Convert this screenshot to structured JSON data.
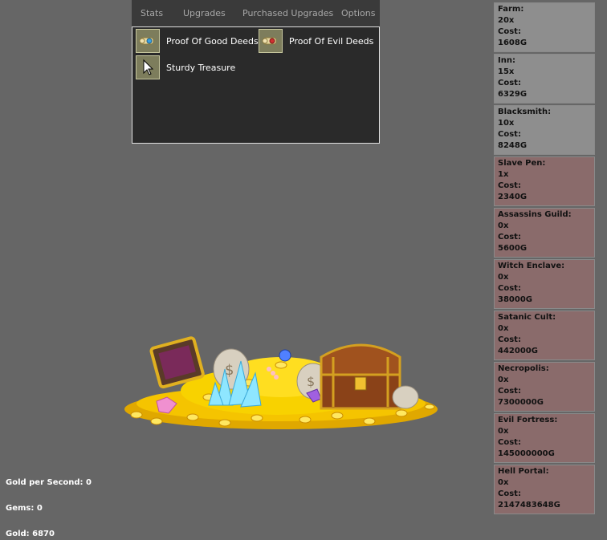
{
  "tabs": {
    "stats": "Stats",
    "upgrades": "Upgrades",
    "purchased": "Purchased Upgrades",
    "options": "Options"
  },
  "upgrades": [
    {
      "label": "Proof Of Good Deeds",
      "icon": "scroll-good-icon"
    },
    {
      "label": "Proof Of Evil Deeds",
      "icon": "scroll-evil-icon"
    },
    {
      "label": "Sturdy Treasure",
      "icon": "cursor-icon"
    }
  ],
  "buildings": [
    {
      "name": "Farm:",
      "count": "20x",
      "cost_label": "Cost:",
      "cost": "1608G",
      "type": "good"
    },
    {
      "name": "Inn:",
      "count": "15x",
      "cost_label": "Cost:",
      "cost": "6329G",
      "type": "good"
    },
    {
      "name": "Blacksmith:",
      "count": "10x",
      "cost_label": "Cost:",
      "cost": "8248G",
      "type": "good"
    },
    {
      "name": "Slave Pen:",
      "count": "1x",
      "cost_label": "Cost:",
      "cost": "2340G",
      "type": "evil"
    },
    {
      "name": "Assassins Guild:",
      "count": "0x",
      "cost_label": "Cost:",
      "cost": "5600G",
      "type": "evil"
    },
    {
      "name": "Witch Enclave:",
      "count": "0x",
      "cost_label": "Cost:",
      "cost": "38000G",
      "type": "evil"
    },
    {
      "name": "Satanic Cult:",
      "count": "0x",
      "cost_label": "Cost:",
      "cost": "442000G",
      "type": "evil"
    },
    {
      "name": "Necropolis:",
      "count": "0x",
      "cost_label": "Cost:",
      "cost": "7300000G",
      "type": "evil"
    },
    {
      "name": "Evil Fortress:",
      "count": "0x",
      "cost_label": "Cost:",
      "cost": "145000000G",
      "type": "evil"
    },
    {
      "name": "Hell Portal:",
      "count": "0x",
      "cost_label": "Cost:",
      "cost": "2147483648G",
      "type": "evil"
    }
  ],
  "stats": {
    "gold_per_second": "Gold per Second: 0",
    "gems": "Gems: 0",
    "gold": "Gold: 6870"
  },
  "colors": {
    "background": "#666666",
    "good_building": "#8e8e8e",
    "evil_building": "#8a6b6b",
    "panel": "#2a2a2a"
  }
}
